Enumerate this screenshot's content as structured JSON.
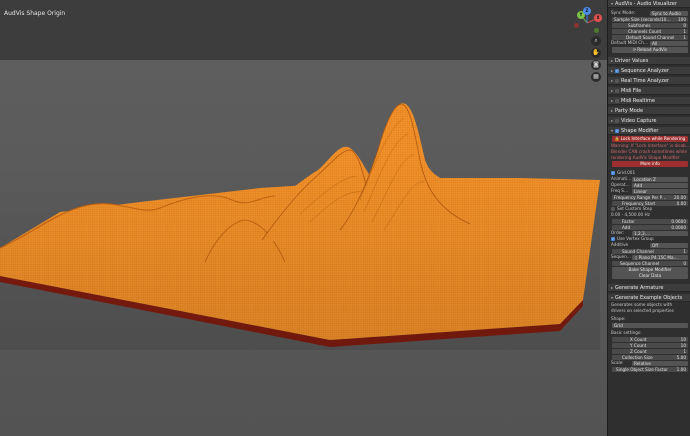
{
  "viewport": {
    "title": "AudVis Shape Origin",
    "gizmo": {
      "x_label": "X",
      "y_label": "Y",
      "z_label": "Z"
    }
  },
  "panel": {
    "header": "AudVis - Audio Visualizer",
    "sync_mode_label": "Sync Mode:",
    "sync_mode_value": "Sync to Audio",
    "sample_size_label": "Sample Size (seconds/10…",
    "sample_size_value": "100",
    "subframes_label": "Subframes",
    "subframes_value": "0",
    "channels_count_label": "Channels Count",
    "channels_count_value": "1",
    "default_sound_channel_label": "Default Sound Channel",
    "default_sound_channel_value": "1",
    "default_midi_label": "Default MIDI Ch…",
    "default_midi_value": "All",
    "reload_button": "Reload AudVis",
    "sections": [
      "Driver Values",
      "Sequence Analyzer",
      "Real Time Analyzer",
      "Midi File",
      "Midi Realtime",
      "Party Mode",
      "Video Capture",
      "Shape Modifier"
    ],
    "shape_modifier": {
      "lock_button": "Lock Interface while Rendering",
      "warning_lines": [
        "Warning: If \"Lock Interface\" is disab…",
        "Blender CAN crash sometimes while",
        "rendering AudVis Shape Modifier"
      ],
      "more_info_button": "More info",
      "object_name": "Grid.001",
      "animate_label": "Animati…",
      "animate_value": "Location Z",
      "operation_label": "Operat…",
      "operation_value": "Add",
      "freq_label": "Freq S…",
      "freq_value": "Linear",
      "freq_range_label": "Frequency Range Per P…",
      "freq_range_value": "20.00",
      "freq_start_label": "Frequency Start",
      "freq_start_value": "0.00",
      "custom_step_label": "Set Custom Step",
      "custom_step_range": "0.00 - 4,500.00 Hz",
      "factor_label": "Factor",
      "factor_value": "0.0600",
      "add_label": "Add",
      "add_value": "0.0000",
      "order_label": "Order:",
      "order_value": "1,2,3,…",
      "use_vertex_group": "Use Vertex Group",
      "additive_label": "Additive",
      "additive_value": "Off",
      "sound_channel_label": "Sound Channel",
      "sound_channel_value": "1",
      "sequence_label": "Sequen…",
      "sequence_value": "Piano P4.15C Ma…",
      "sequence_channel_label": "Sequence Channel",
      "sequence_channel_value": "0",
      "bake_button": "Bake Shape Modifier",
      "clear_button": "Clear Data"
    },
    "generate_armature": "Generate Armature",
    "generate_examples": {
      "header": "Generate Example Objects",
      "desc_lines": [
        "Generates some objects with",
        "drivers on selected properties"
      ],
      "shape_label": "Shape:",
      "shape_value": "Grid",
      "basic_settings": "Basic settings:",
      "x_count_label": "X Count",
      "x_count_value": "10",
      "y_count_label": "Y Count",
      "y_count_value": "10",
      "z_count_label": "Z Count",
      "z_count_value": "1",
      "collection_size_label": "Collection Size",
      "collection_size_value": "5.00",
      "scale_label": "Scale:",
      "scale_value": "Relative",
      "single_size_label": "Single Object Size Factor",
      "single_size_value": "1.00"
    }
  },
  "colors": {
    "mesh": "#f08a20",
    "mesh_dark": "#c86610",
    "mesh_edge": "#8a1f10",
    "accent_red": "#9e2f2f",
    "checkbox": "#4a88d8"
  }
}
